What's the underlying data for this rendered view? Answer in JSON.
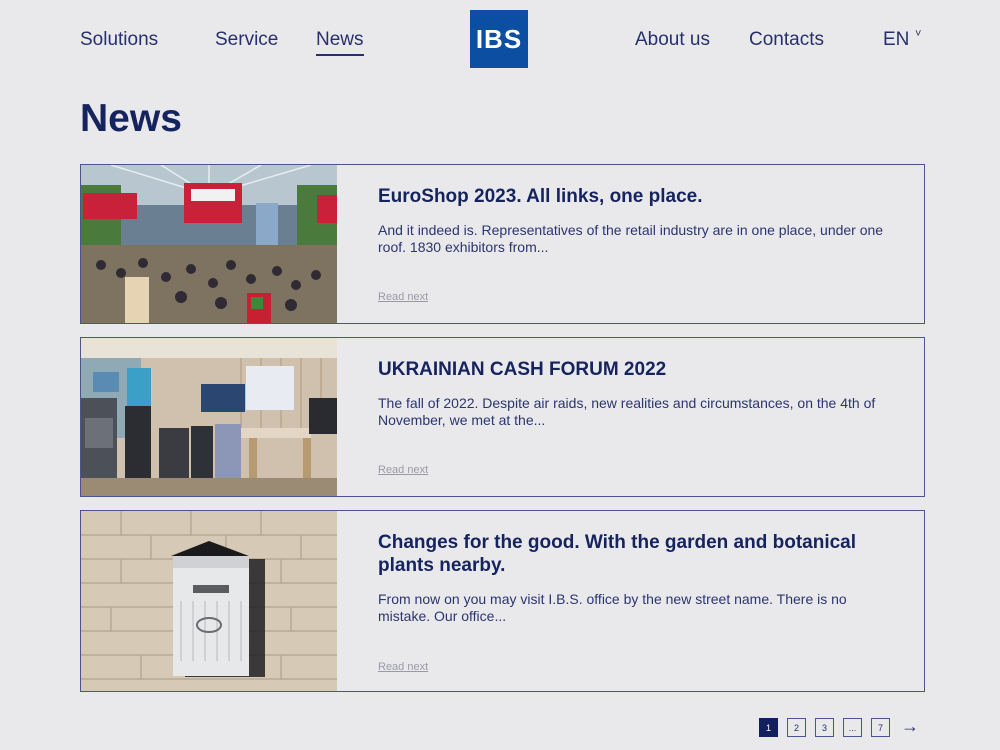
{
  "nav": {
    "left_items": [
      "Solutions",
      "Service",
      "News"
    ],
    "right_items": [
      "About us",
      "Contacts"
    ],
    "logo_text": "IBS",
    "language": "EN",
    "chevron_icon": "chevron-down-icon"
  },
  "page": {
    "title": "News"
  },
  "news": [
    {
      "title": "EuroShop 2023. All links, one place.",
      "text": "And it indeed is. Representatives of the retail industry are in one place, under one roof. 1830 exhibitors from...",
      "more": "Read next"
    },
    {
      "title": "UKRAINIAN CASH FORUM 2022",
      "text": "The fall of 2022. Despite air raids, new realities and circumstances, on the 4th of November, we met at the...",
      "more": "Read next"
    },
    {
      "title": "Changes for the good. With the garden and botanical plants nearby.",
      "text": "From now on you may visit I.B.S. office by the new street name. There is no mistake. Our office...",
      "more": "Read next"
    }
  ],
  "pagination": {
    "pages": [
      "1",
      "2",
      "3",
      "...",
      "7"
    ],
    "active": "1",
    "next_icon": "arrow-right-icon",
    "next_glyph": "→"
  },
  "colors": {
    "brand_blue": "#0b4ea2",
    "navy": "#15235e",
    "background": "#e9e9ec"
  }
}
